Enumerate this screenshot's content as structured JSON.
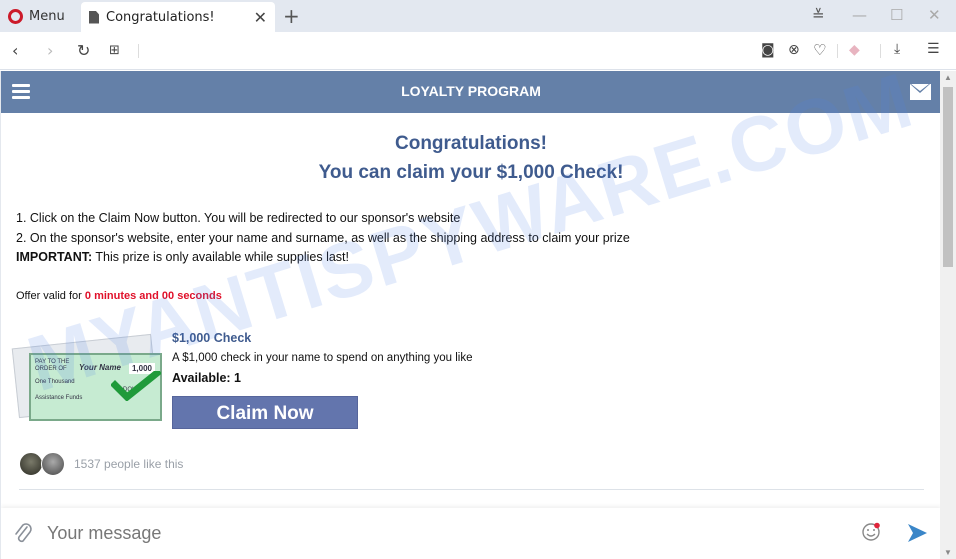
{
  "browser": {
    "menu_label": "Menu",
    "tab_title": "Congratulations!",
    "new_tab": "+",
    "close_tab": "✕"
  },
  "page": {
    "header_title": "LOYALTY PROGRAM",
    "heading_1": "Congratulations!",
    "heading_2": "You can claim your $1,000 Check!",
    "step_1": "1. Click on the Claim Now button. You will be redirected to our sponsor's website",
    "step_2": "2. On the sponsor's website, enter your name and surname, as well as the shipping address to claim your prize",
    "important_label": "IMPORTANT:",
    "important_text": " This prize is only available while supplies last!",
    "offer_prefix": "Offer valid for ",
    "offer_timer": "0 minutes and 00 seconds",
    "product": {
      "title": "$1,000 Check",
      "description": "A $1,000 check in your name to spend on anything you like",
      "available": "Available: 1",
      "cta": "Claim Now",
      "check_image": {
        "pay_to": "PAY TO THE ORDER OF",
        "name": "Your Name",
        "amount": "1,000",
        "words": "One Thousand",
        "memo": "Assistance Funds",
        "dollars": "DOLL"
      }
    },
    "likes_text": "1537 people like this",
    "message_placeholder": "Your message",
    "accent_color": "#6480a8",
    "timer_color": "#e0112b"
  },
  "watermark": "MYANTISPYWARE.COM"
}
